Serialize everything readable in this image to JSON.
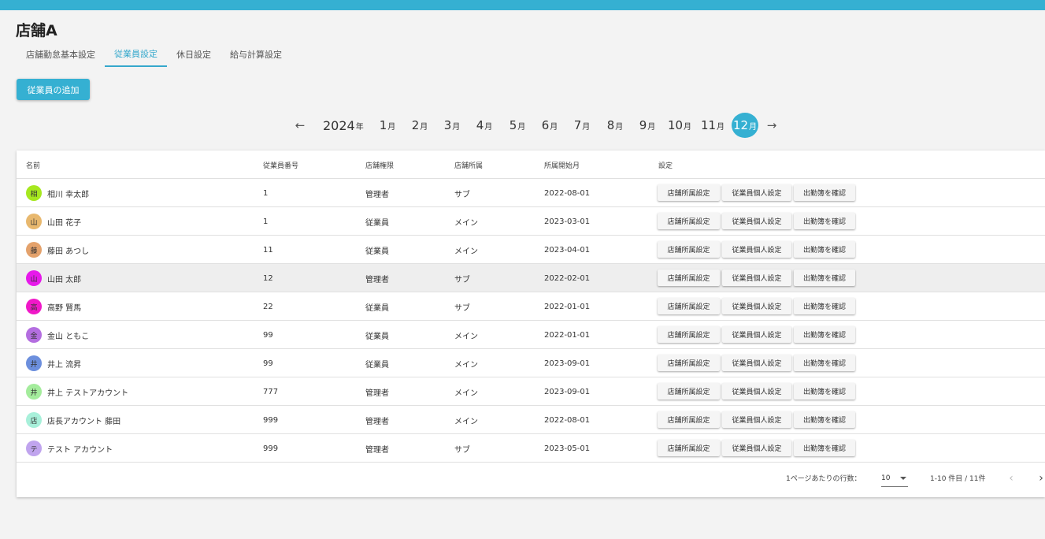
{
  "store": {
    "title": "店舗A"
  },
  "tabs": [
    {
      "label": "店舗勤怠基本設定"
    },
    {
      "label": "従業員設定"
    },
    {
      "label": "休日設定"
    },
    {
      "label": "給与計算設定"
    }
  ],
  "add_button": "従業員の追加",
  "month_nav": {
    "prev_icon": "arrow-left-icon",
    "next_icon": "arrow-right-icon",
    "year": "2024",
    "year_suffix": "年",
    "month_suffix": "月",
    "months": [
      "1",
      "2",
      "3",
      "4",
      "5",
      "6",
      "7",
      "8",
      "9",
      "10",
      "11",
      "12"
    ],
    "selected_month": "12"
  },
  "table": {
    "headers": {
      "name": "名前",
      "number": "従業員番号",
      "role": "店舗権限",
      "affiliation": "店舗所属",
      "start": "所属開始月",
      "settings": "設定"
    },
    "action_labels": {
      "store_setting": "店舗所属設定",
      "personal_setting": "従業員個人設定",
      "attendance": "出勤簿を確認"
    },
    "rows": [
      {
        "initial": "相",
        "avatar_color": "#a6e81f",
        "name": "相川 幸太郎",
        "number": "1",
        "role": "管理者",
        "affiliation": "サブ",
        "start": "2022-08-01"
      },
      {
        "initial": "山",
        "avatar_color": "#e8b86e",
        "name": "山田 花子",
        "number": "1",
        "role": "従業員",
        "affiliation": "メイン",
        "start": "2023-03-01"
      },
      {
        "initial": "藤",
        "avatar_color": "#e4a26c",
        "name": "藤田 あつし",
        "number": "11",
        "role": "従業員",
        "affiliation": "メイン",
        "start": "2023-04-01"
      },
      {
        "initial": "山",
        "avatar_color": "#e619ea",
        "name": "山田 太郎",
        "number": "12",
        "role": "管理者",
        "affiliation": "サブ",
        "start": "2022-02-01"
      },
      {
        "initial": "高",
        "avatar_color": "#f018c8",
        "name": "高野 賢馬",
        "number": "22",
        "role": "従業員",
        "affiliation": "サブ",
        "start": "2022-01-01"
      },
      {
        "initial": "金",
        "avatar_color": "#b46ee0",
        "name": "金山 ともこ",
        "number": "99",
        "role": "従業員",
        "affiliation": "メイン",
        "start": "2022-01-01"
      },
      {
        "initial": "井",
        "avatar_color": "#6c8fdd",
        "name": "井上 流昇",
        "number": "99",
        "role": "従業員",
        "affiliation": "メイン",
        "start": "2023-09-01"
      },
      {
        "initial": "井",
        "avatar_color": "#a4ec9c",
        "name": "井上 テストアカウント",
        "number": "777",
        "role": "管理者",
        "affiliation": "メイン",
        "start": "2023-09-01"
      },
      {
        "initial": "店",
        "avatar_color": "#a8f0da",
        "name": "店長アカウント 藤田",
        "number": "999",
        "role": "管理者",
        "affiliation": "メイン",
        "start": "2022-08-01"
      },
      {
        "initial": "テ",
        "avatar_color": "#c0a4ee",
        "name": "テスト アカウント",
        "number": "999",
        "role": "管理者",
        "affiliation": "サブ",
        "start": "2023-05-01"
      }
    ],
    "highlighted_row": 3
  },
  "pagination": {
    "rows_per_page_label": "1ページあたりの行数：",
    "rows_per_page": "10",
    "range": "1-10 件目 / 11件",
    "prev_icon": "chevron-left-icon",
    "next_icon": "chevron-right-icon"
  },
  "colors": {
    "accent": "#35b0d2"
  }
}
